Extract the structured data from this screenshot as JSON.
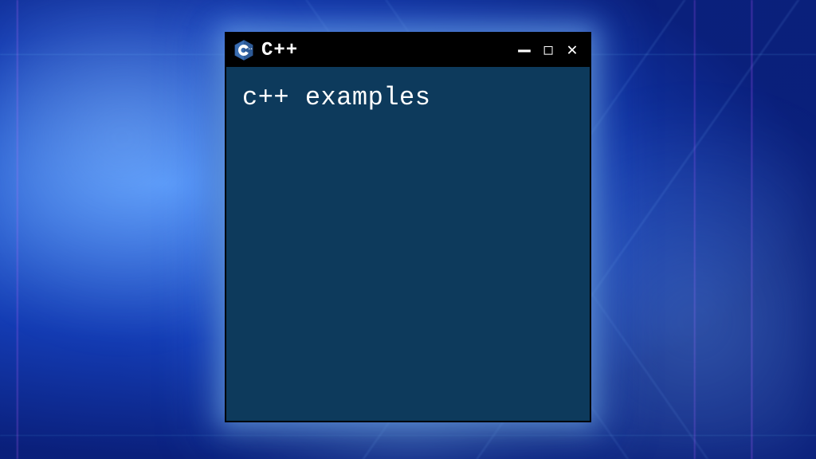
{
  "window": {
    "title": "C++",
    "controls": {
      "minimize": "—",
      "maximize": "□",
      "close": "✕"
    }
  },
  "body": {
    "content": "c++ examples"
  },
  "icons": {
    "cpp_logo": "cpp-logo-icon"
  },
  "colors": {
    "window_bg": "#0d3a5c",
    "titlebar_bg": "#000000",
    "text": "#ffffff",
    "glow": "#5aa0ff"
  }
}
